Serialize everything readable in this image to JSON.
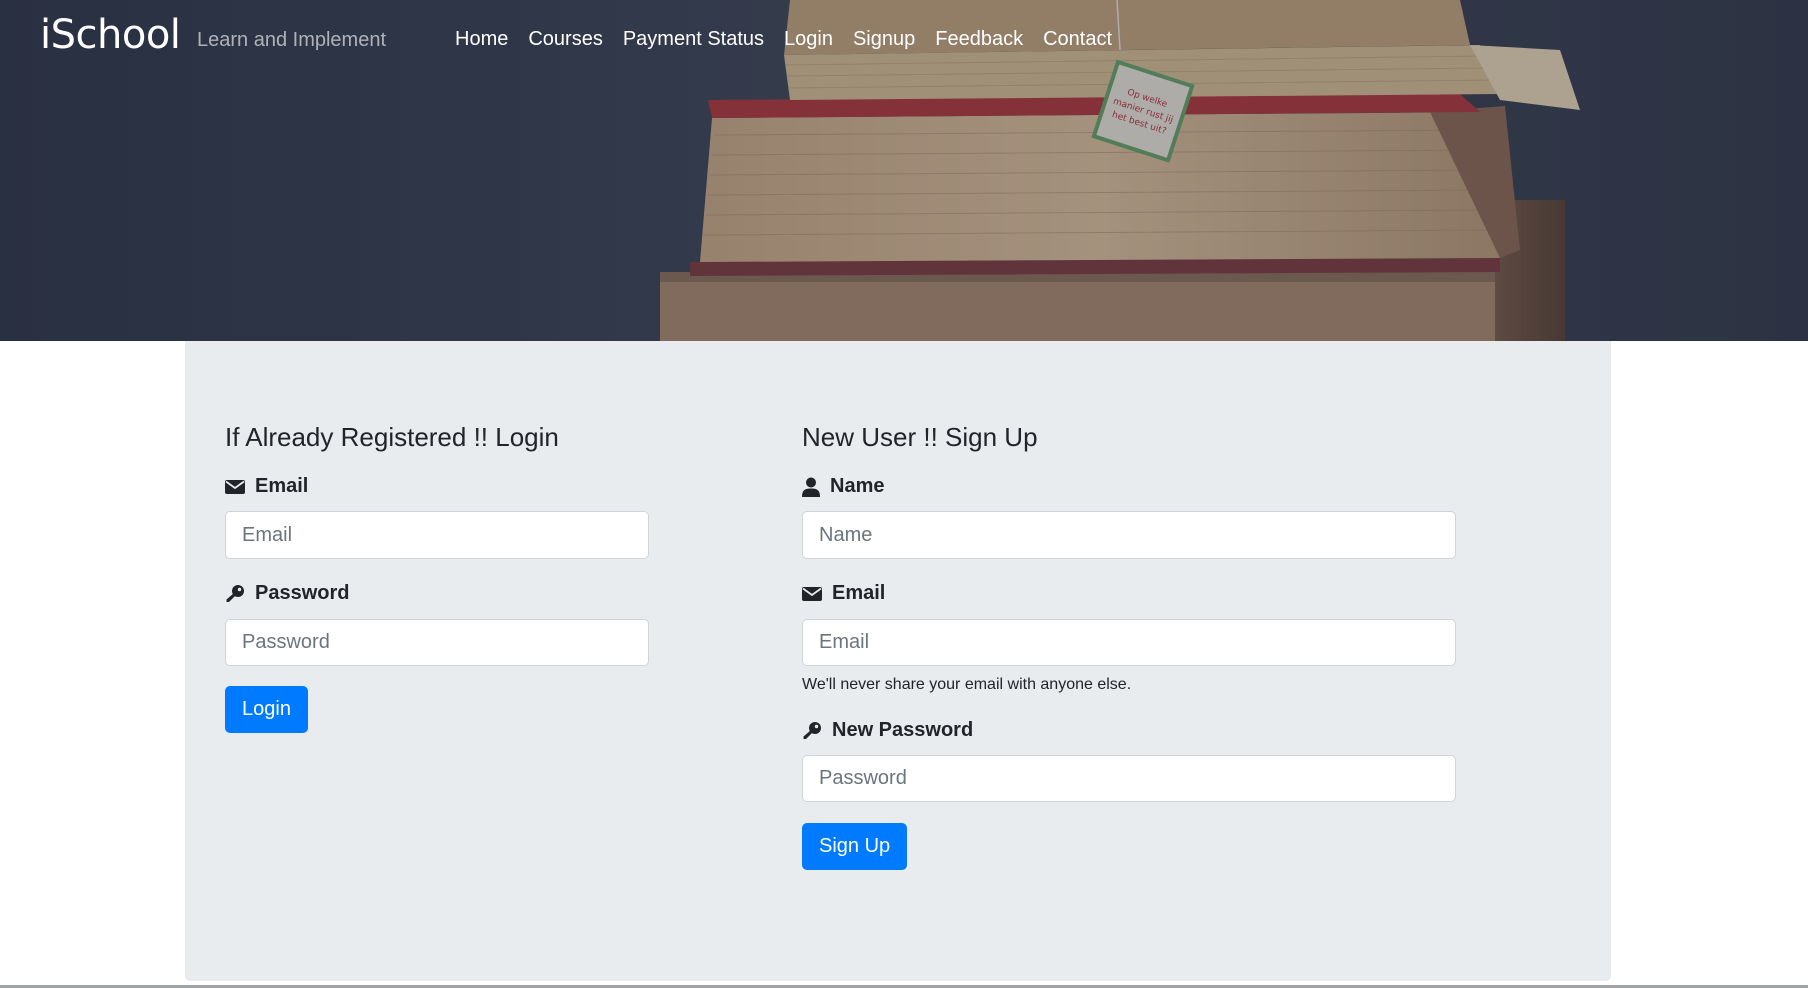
{
  "header": {
    "brand": "iSchool",
    "tagline": "Learn and Implement",
    "nav": [
      "Home",
      "Courses",
      "Payment Status",
      "Login",
      "Signup",
      "Feedback",
      "Contact"
    ],
    "book_tag_text": [
      "Op welke",
      "manier rust jij",
      "het best uit?"
    ]
  },
  "login": {
    "title": "If Already Registered !! Login",
    "email_label": "Email",
    "email_placeholder": "Email",
    "password_label": "Password",
    "password_placeholder": "Password",
    "button": "Login"
  },
  "signup": {
    "title": "New User !! Sign Up",
    "name_label": "Name",
    "name_placeholder": "Name",
    "email_label": "Email",
    "email_placeholder": "Email",
    "email_help": "We'll never share your email with anyone else.",
    "password_label": "New Password",
    "password_placeholder": "Password",
    "button": "Sign Up"
  },
  "icons": {
    "email": "envelope-icon",
    "password": "key-icon",
    "name": "user-icon"
  },
  "colors": {
    "primary": "#007bff",
    "panel_bg": "#e9ecef",
    "hero_bg": "#3a4254"
  }
}
